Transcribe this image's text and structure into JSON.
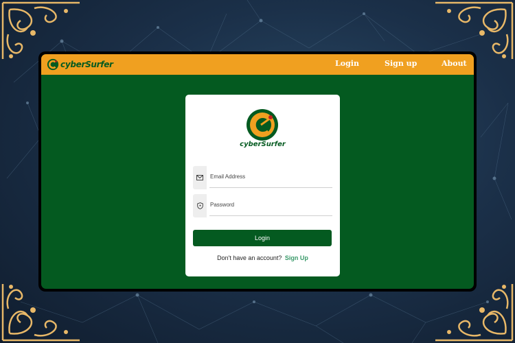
{
  "brand": {
    "name": "cyberSurfer",
    "colors": {
      "green": "#045a20",
      "orange": "#f0a020",
      "link": "#3a9a6a"
    }
  },
  "navbar": {
    "logo_icon": "cybersurfer-logo-icon",
    "links": [
      {
        "label": "Login"
      },
      {
        "label": "Sign up"
      },
      {
        "label": "About"
      }
    ]
  },
  "login_card": {
    "logo_icon": "cybersurfer-logo-icon",
    "brand_name": "cyberSurfer",
    "email": {
      "placeholder": "Email Address",
      "value": "",
      "icon": "envelope-icon"
    },
    "password": {
      "placeholder": "Password",
      "value": "",
      "icon": "shield-lock-icon"
    },
    "login_button": "Login",
    "signup_prompt": "Don't have an account?",
    "signup_link": "Sign Up"
  }
}
